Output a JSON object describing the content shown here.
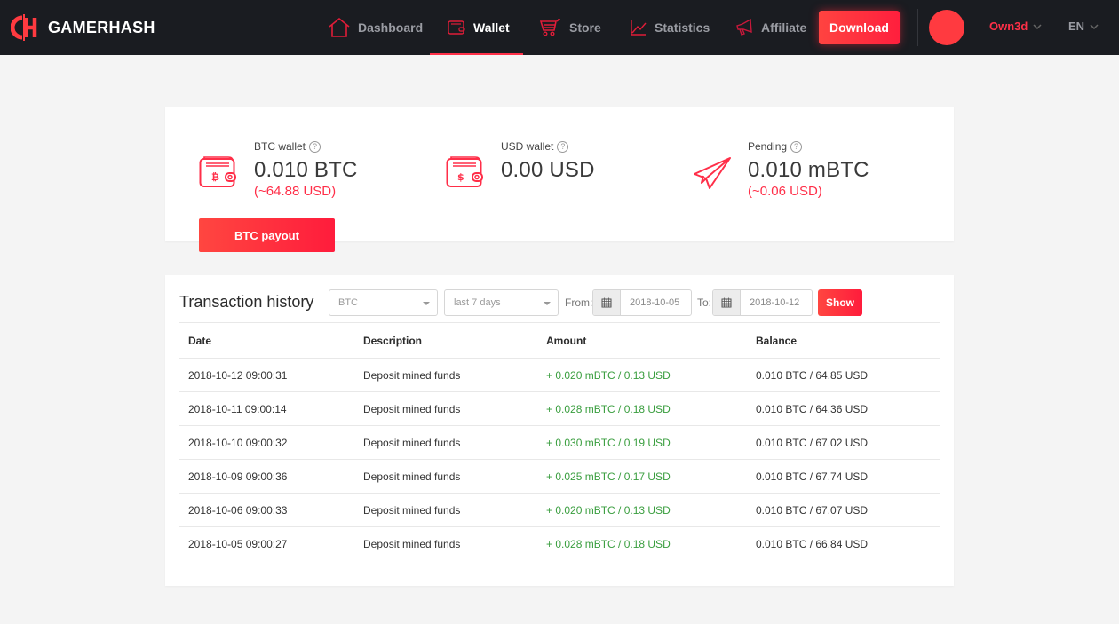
{
  "brand": {
    "name": "GAMERHASH",
    "accent": "#ff3048"
  },
  "nav": {
    "items": [
      {
        "label": "Dashboard",
        "icon": "home-icon",
        "active": false
      },
      {
        "label": "Wallet",
        "icon": "wallet-icon",
        "active": true
      },
      {
        "label": "Store",
        "icon": "cart-icon",
        "active": false
      },
      {
        "label": "Statistics",
        "icon": "chart-line-icon",
        "active": false
      },
      {
        "label": "Affiliate",
        "icon": "megaphone-icon",
        "active": false
      }
    ],
    "download_label": "Download",
    "username": "Own3d",
    "language": "EN"
  },
  "wallets": {
    "btc": {
      "label": "BTC wallet",
      "value": "0.010 BTC",
      "sub": "(~64.88 USD)",
      "icon": "btc-wallet-icon"
    },
    "usd": {
      "label": "USD wallet",
      "value": "0.00 USD",
      "icon": "usd-wallet-icon"
    },
    "pending": {
      "label": "Pending",
      "value": "0.010 mBTC",
      "sub": "(~0.06 USD)",
      "icon": "paper-plane-icon"
    },
    "payout_label": "BTC payout",
    "help_glyph": "?"
  },
  "transactions": {
    "title": "Transaction history",
    "currency_select": "BTC",
    "range_select": "last 7 days",
    "from_label": "From:",
    "from_value": "2018-10-05",
    "to_label": "To:",
    "to_value": "2018-10-12",
    "show_label": "Show",
    "columns": [
      "Date",
      "Description",
      "Amount",
      "Balance"
    ],
    "rows": [
      {
        "date": "2018-10-12 09:00:31",
        "description": "Deposit mined funds",
        "amount": "+ 0.020 mBTC / 0.13 USD",
        "balance": "0.010 BTC / 64.85 USD"
      },
      {
        "date": "2018-10-11 09:00:14",
        "description": "Deposit mined funds",
        "amount": "+ 0.028 mBTC / 0.18 USD",
        "balance": "0.010 BTC / 64.36 USD"
      },
      {
        "date": "2018-10-10 09:00:32",
        "description": "Deposit mined funds",
        "amount": "+ 0.030 mBTC / 0.19 USD",
        "balance": "0.010 BTC / 67.02 USD"
      },
      {
        "date": "2018-10-09 09:00:36",
        "description": "Deposit mined funds",
        "amount": "+ 0.025 mBTC / 0.17 USD",
        "balance": "0.010 BTC / 67.74 USD"
      },
      {
        "date": "2018-10-06 09:00:33",
        "description": "Deposit mined funds",
        "amount": "+ 0.020 mBTC / 0.13 USD",
        "balance": "0.010 BTC / 67.07 USD"
      },
      {
        "date": "2018-10-05 09:00:27",
        "description": "Deposit mined funds",
        "amount": "+ 0.028 mBTC / 0.18 USD",
        "balance": "0.010 BTC / 66.84 USD"
      }
    ]
  }
}
